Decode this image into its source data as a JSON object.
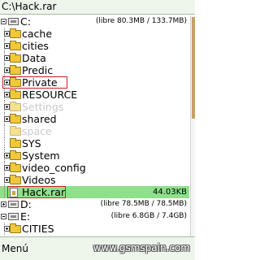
{
  "window": {
    "title": "C:\\Hack.rar"
  },
  "tree": {
    "drive_c": {
      "label": "C:",
      "info": "(libre 80.3MB / 133.7MB)"
    },
    "folders": [
      {
        "label": "cache"
      },
      {
        "label": "cities"
      },
      {
        "label": "Data"
      },
      {
        "label": "Predic"
      },
      {
        "label": "Private"
      },
      {
        "label": "RESOURCE"
      },
      {
        "label": "Settings"
      },
      {
        "label": "shared"
      },
      {
        "label": "space"
      },
      {
        "label": "SYS"
      },
      {
        "label": "System"
      },
      {
        "label": "video_config"
      },
      {
        "label": "Videos"
      }
    ],
    "file": {
      "label": "Hack.rar",
      "size": "44.03KB"
    },
    "drive_d": {
      "label": "D:",
      "info": "(libre 78.5MB / 78.5MB)"
    },
    "drive_e": {
      "label": "E:",
      "info": "(libre 6.8GB / 7.4GB)"
    },
    "e_folders": [
      {
        "label": "CITIES"
      }
    ]
  },
  "softkeys": {
    "left": "Menú"
  },
  "watermark": "www.gsmspain.com",
  "colors": {
    "selection": "#8ee08a",
    "highlight_box": "#d02020",
    "folder": "#f0c838"
  },
  "icons": {
    "folder": "folder-icon",
    "drive": "drive-icon",
    "file": "file-icon",
    "expand": "expand-icon",
    "collapse": "collapse-icon"
  }
}
